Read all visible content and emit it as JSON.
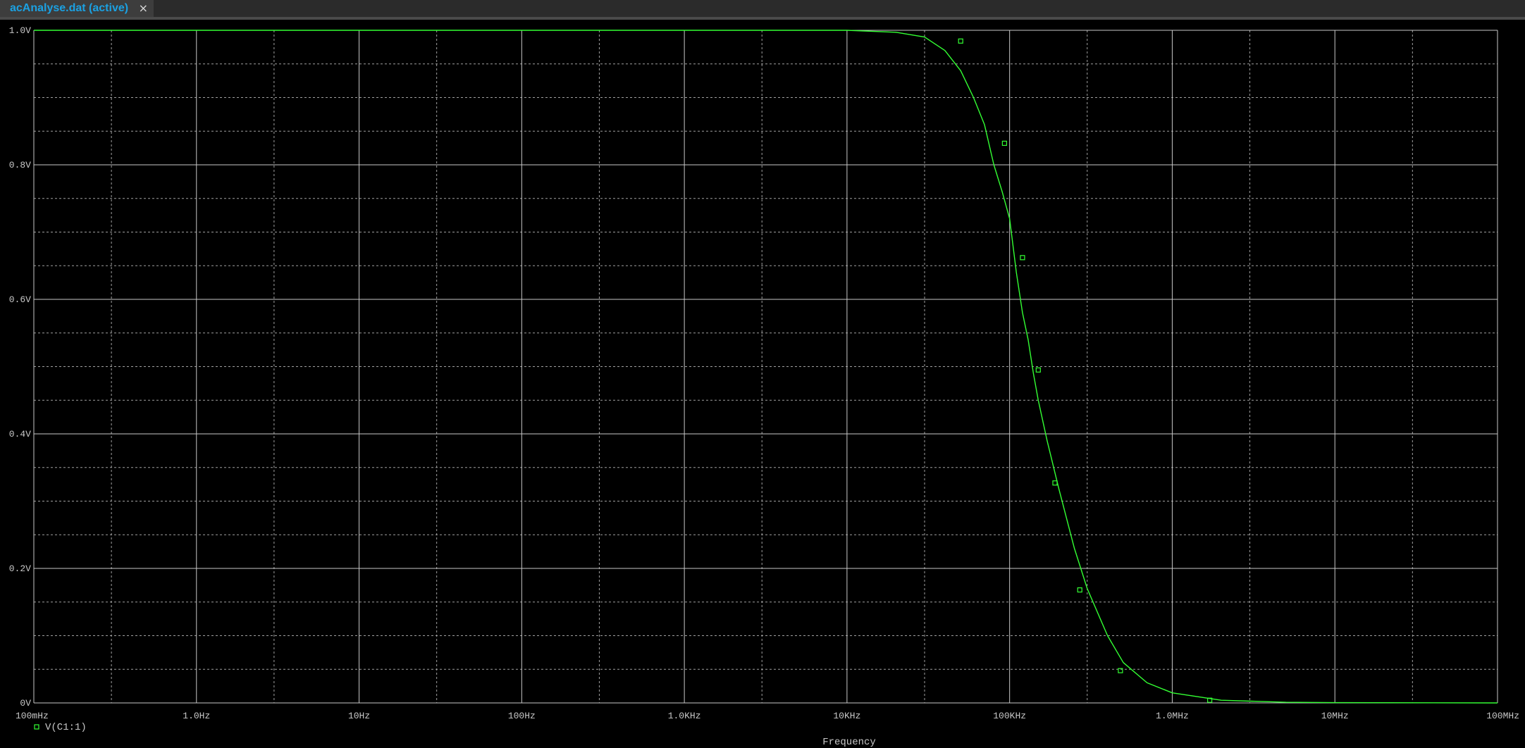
{
  "tab": {
    "label": "acAnalyse.dat (active)",
    "close_glyph": "×"
  },
  "colors": {
    "background": "#000000",
    "grid_major": "#c8c8c8",
    "grid_minor": "#a0a0a0",
    "trace": "#33ff33",
    "axis_text": "#c8c8c8",
    "tab_text": "#1ba1e2"
  },
  "chart_data": {
    "type": "line",
    "title": "",
    "xlabel": "Frequency",
    "ylabel": "",
    "x_scale": "log",
    "xlim": [
      0.1,
      100000000
    ],
    "ylim": [
      0,
      1.0
    ],
    "grid": true,
    "legend_placement": "bottom-left",
    "x_ticks": [
      {
        "value": 0.1,
        "label": "100mHz"
      },
      {
        "value": 1,
        "label": "1.0Hz"
      },
      {
        "value": 10,
        "label": "10Hz"
      },
      {
        "value": 100,
        "label": "100Hz"
      },
      {
        "value": 1000,
        "label": "1.0KHz"
      },
      {
        "value": 10000,
        "label": "10KHz"
      },
      {
        "value": 100000,
        "label": "100KHz"
      },
      {
        "value": 1000000,
        "label": "1.0MHz"
      },
      {
        "value": 10000000,
        "label": "10MHz"
      },
      {
        "value": 100000000,
        "label": "100MHz"
      }
    ],
    "y_ticks": [
      {
        "value": 0,
        "label": "0V"
      },
      {
        "value": 0.2,
        "label": "0.2V"
      },
      {
        "value": 0.4,
        "label": "0.4V"
      },
      {
        "value": 0.6,
        "label": "0.6V"
      },
      {
        "value": 0.8,
        "label": "0.8V"
      },
      {
        "value": 1.0,
        "label": "1.0V"
      }
    ],
    "series": [
      {
        "name": "V(C1:1)",
        "color": "#33ff33",
        "marker": "square",
        "x": [
          0.1,
          1000,
          10000,
          20000,
          30000,
          40000,
          50000,
          60000,
          70000,
          80000,
          90000,
          100000,
          110000,
          120000,
          130000,
          140000,
          150000,
          170000,
          200000,
          250000,
          300000,
          400000,
          500000,
          700000,
          1000000,
          2000000,
          5000000,
          10000000,
          100000000
        ],
        "values": [
          1.0,
          1.0,
          1.0,
          0.997,
          0.99,
          0.97,
          0.94,
          0.9,
          0.86,
          0.8,
          0.76,
          0.72,
          0.64,
          0.58,
          0.54,
          0.49,
          0.45,
          0.39,
          0.32,
          0.23,
          0.17,
          0.1,
          0.06,
          0.03,
          0.015,
          0.004,
          0.001,
          0.0005,
          0.0
        ],
        "marker_x": [
          50000,
          93000,
          120000,
          150000,
          190000,
          270000,
          480000,
          1700000
        ],
        "marker_values": [
          0.984,
          0.832,
          0.662,
          0.495,
          0.327,
          0.168,
          0.048,
          0.004
        ]
      }
    ]
  }
}
